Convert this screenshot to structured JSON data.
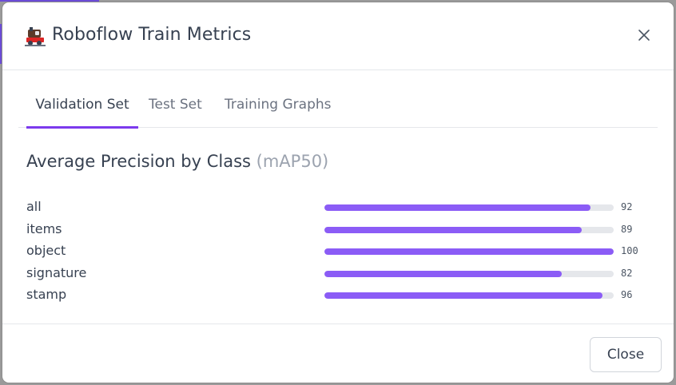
{
  "modal": {
    "title": "Roboflow Train Metrics",
    "title_icon": "train-icon",
    "close_icon": "close-icon"
  },
  "tabs": [
    {
      "label": "Validation Set",
      "active": true
    },
    {
      "label": "Test Set",
      "active": false
    },
    {
      "label": "Training Graphs",
      "active": false
    }
  ],
  "section": {
    "title": "Average Precision by Class",
    "subtitle": "(mAP50)"
  },
  "classes": [
    {
      "label": "all",
      "value": "92",
      "fraction": 0.92
    },
    {
      "label": "items",
      "value": "89",
      "fraction": 0.89
    },
    {
      "label": "object",
      "value": "100",
      "fraction": 1.0
    },
    {
      "label": "signature",
      "value": "82",
      "fraction": 0.82
    },
    {
      "label": "stamp",
      "value": "96",
      "fraction": 0.96
    }
  ],
  "footer": {
    "close_label": "Close"
  },
  "colors": {
    "accent": "#7c3aed",
    "bar": "#8b5cf6",
    "track": "#e5e7eb"
  }
}
